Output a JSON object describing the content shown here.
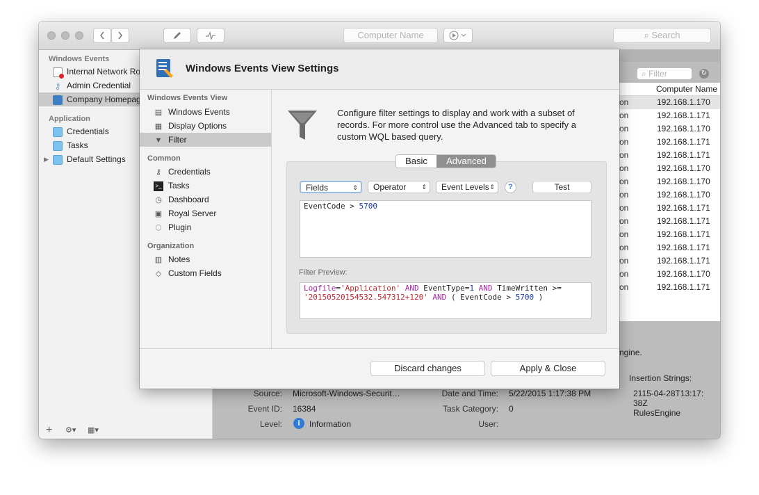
{
  "toolbar": {
    "back_icon": "chevron-left",
    "forward_icon": "chevron-right",
    "edit_icon": "pencil",
    "activity_icon": "pulse",
    "computer_name_placeholder": "Computer Name",
    "play_icon": "play-circle",
    "search_placeholder": "Search"
  },
  "sidebar": {
    "groups": [
      {
        "title": "Windows Events",
        "items": [
          "Internal Network Ro",
          "Admin Credential",
          "Company Homepag"
        ]
      },
      {
        "title": "Application",
        "items": [
          "Credentials",
          "Tasks",
          "Default Settings"
        ]
      }
    ],
    "footer": {
      "add": "+",
      "gear": "⚙▾",
      "grid": "▦▾"
    }
  },
  "list": {
    "filter_placeholder": "Filter",
    "column": "Computer Name",
    "rows": [
      {
        "c": "on",
        "ip": "192.168.1.170"
      },
      {
        "c": "on",
        "ip": "192.168.1.171"
      },
      {
        "c": "on",
        "ip": "192.168.1.170"
      },
      {
        "c": "on",
        "ip": "192.168.1.171"
      },
      {
        "c": "on",
        "ip": "192.168.1.171"
      },
      {
        "c": "on",
        "ip": "192.168.1.170"
      },
      {
        "c": "on",
        "ip": "192.168.1.170"
      },
      {
        "c": "on",
        "ip": "192.168.1.170"
      },
      {
        "c": "on",
        "ip": "192.168.1.171"
      },
      {
        "c": "on",
        "ip": "192.168.1.171"
      },
      {
        "c": "on",
        "ip": "192.168.1.171"
      },
      {
        "c": "on",
        "ip": "192.168.1.171"
      },
      {
        "c": "on",
        "ip": "192.168.1.171"
      },
      {
        "c": "on",
        "ip": "192.168.1.170"
      },
      {
        "c": "on",
        "ip": "192.168.1.171"
      }
    ]
  },
  "details": {
    "engine_fragment": "ngine.",
    "insertion_label": "Insertion Strings:",
    "insertion_value_1": "2115-04-28T13:17:",
    "insertion_value_2": "38Z",
    "insertion_value_3": "RulesEngine",
    "source_label": "Source:",
    "source_value": "Microsoft-Windows-Securit…",
    "eventid_label": "Event ID:",
    "eventid_value": "16384",
    "level_label": "Level:",
    "level_value": "Information",
    "date_label": "Date and Time:",
    "date_value": "5/22/2015 1:17:38 PM",
    "task_label": "Task Category:",
    "task_value": "0",
    "user_label": "User:"
  },
  "dialog": {
    "title": "Windows Events View Settings",
    "nav": {
      "sections": [
        {
          "title": "Windows Events View",
          "items": [
            "Windows Events",
            "Display Options",
            "Filter"
          ]
        },
        {
          "title": "Common",
          "items": [
            "Credentials",
            "Tasks",
            "Dashboard",
            "Royal Server",
            "Plugin"
          ]
        },
        {
          "title": "Organization",
          "items": [
            "Notes",
            "Custom Fields"
          ]
        }
      ],
      "selected": "Filter"
    },
    "description": "Configure filter settings to display and work with a subset of records. For more control use the Advanced tab to specify a custom WQL based query.",
    "tabs": [
      "Basic",
      "Advanced"
    ],
    "active_tab": "Advanced",
    "fields_label": "Fields",
    "operator_label": "Operator",
    "event_levels_label": "Event Levels",
    "help_label": "?",
    "test_label": "Test",
    "query_field": "EventCode > ",
    "query_value": "5700",
    "preview_label": "Filter Preview:",
    "preview": {
      "t1": "Logfile",
      "t2": "=",
      "t3": "'Application'",
      "t4": " AND ",
      "t5": "EventType",
      "t6": "=",
      "t7": "1",
      "t8": " AND ",
      "t9": "TimeWritten >=",
      "t10": "'20150520154532.547312+120'",
      "t11": " AND ",
      "t12": " ( EventCode > ",
      "t13": "5700",
      "t14": " )"
    },
    "discard_label": "Discard changes",
    "apply_label": "Apply & Close"
  },
  "colors": {
    "keyword": "#a626a4",
    "string": "#c1272d",
    "number": "#1c3fa8",
    "selection": "#cacaca"
  }
}
